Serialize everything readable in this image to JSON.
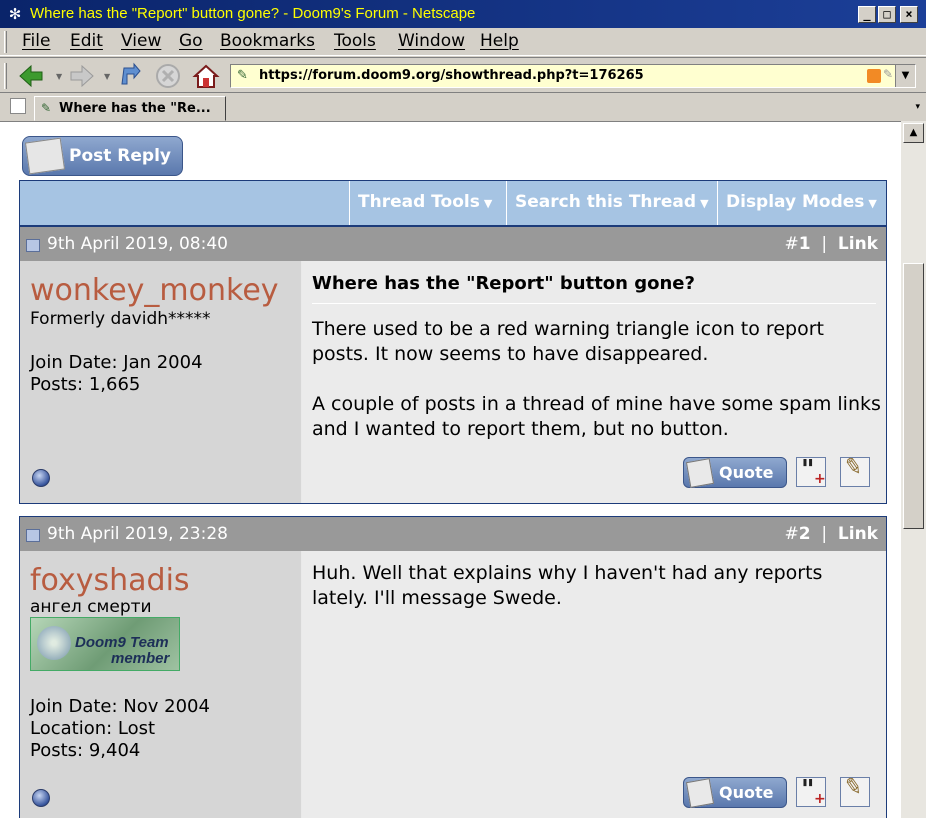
{
  "window": {
    "title": "Where has the \"Report\" button gone? - Doom9's Forum - Netscape",
    "min_glyph": "_",
    "max_glyph": "□",
    "close_glyph": "×"
  },
  "menu": [
    "File",
    "Edit",
    "View",
    "Go",
    "Bookmarks",
    "Tools",
    "Window",
    "Help"
  ],
  "nav": {
    "url": "https://forum.doom9.org/showthread.php?t=176265"
  },
  "tab": {
    "label": "Where has the \"Re..."
  },
  "page": {
    "post_reply_label": "Post Reply",
    "tools": [
      "Thread Tools",
      "Search this Thread",
      "Display Modes"
    ],
    "link_label": "Link",
    "quote_label": "Quote"
  },
  "posts": [
    {
      "date": "9th April 2019, 08:40",
      "number_prefix": "#",
      "number": "1",
      "username": "wonkey_monkey",
      "user_title": "Formerly davidh*****",
      "join_date": "Join Date: Jan 2004",
      "posts": "Posts: 1,665",
      "title": "Where has the \"Report\" button gone?",
      "paragraphs": [
        "There used to be a red warning triangle icon to report posts. It now seems to have disappeared.",
        "A couple of posts in a thread of mine have some spam links and I wanted to report them, but no button."
      ]
    },
    {
      "date": "9th April 2019, 23:28",
      "number_prefix": "#",
      "number": "2",
      "username": "foxyshadis",
      "user_title": "ангел смерти",
      "badge_line1": "Doom9 Team",
      "badge_line2": "member",
      "join_date": "Join Date: Nov 2004",
      "location": "Location: Lost",
      "posts": "Posts: 9,404",
      "paragraphs": [
        "Huh. Well that explains why I haven't had any reports lately. I'll message Swede."
      ]
    }
  ],
  "colors": {
    "titlebar": "#0a246a",
    "title_text": "#ffff00",
    "username": "#b85c40",
    "tools_bar": "#a6c4e3",
    "post_header": "#999999"
  }
}
